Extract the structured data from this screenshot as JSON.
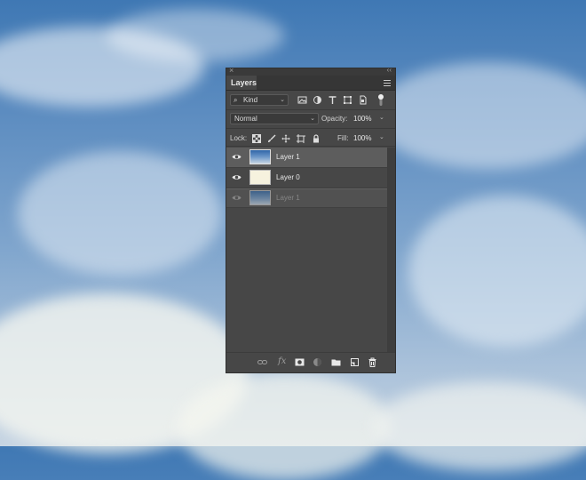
{
  "panel": {
    "close_glyph": "×",
    "collapse_glyph": "‹‹",
    "tab_label": "Layers",
    "menu_icon": "panel-menu-icon"
  },
  "filter": {
    "kind_label": "Kind",
    "icons": [
      "pixel-filter-icon",
      "adjustment-filter-icon",
      "type-filter-icon",
      "shape-filter-icon",
      "smart-object-filter-icon",
      "filter-toggle-icon"
    ]
  },
  "blend": {
    "mode": "Normal",
    "opacity_label": "Opacity:",
    "opacity_value": "100%"
  },
  "lock": {
    "label": "Lock:",
    "icons": [
      "lock-transparent-pixels-icon",
      "lock-image-pixels-icon",
      "lock-position-icon",
      "lock-artboard-icon",
      "lock-all-icon"
    ],
    "fill_label": "Fill:",
    "fill_value": "100%"
  },
  "layers": [
    {
      "name": "Layer 1",
      "selected": true,
      "visible": true,
      "thumb": "sky"
    },
    {
      "name": "Layer 0",
      "selected": false,
      "visible": true,
      "thumb": "paper"
    }
  ],
  "drag_ghost": {
    "name": "Layer 1"
  },
  "footer_icons": [
    "link-layers-icon",
    "fx-icon",
    "layer-mask-icon",
    "adjustment-layer-icon",
    "group-folder-icon",
    "new-layer-icon",
    "trash-icon"
  ],
  "fx_label": "fx"
}
